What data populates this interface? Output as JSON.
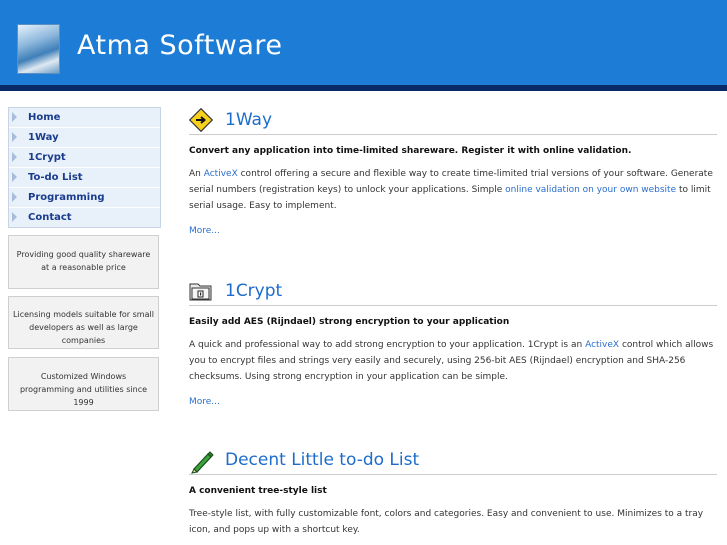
{
  "header": {
    "site_title": "Atma Software"
  },
  "nav": {
    "items": [
      {
        "label": "Home"
      },
      {
        "label": "1Way"
      },
      {
        "label": "1Crypt"
      },
      {
        "label": "To-do List"
      },
      {
        "label": "Programming"
      },
      {
        "label": "Contact"
      }
    ]
  },
  "side_boxes": [
    {
      "text": "Providing good quality shareware at a reasonable price"
    },
    {
      "text": "Licensing models suitable for small developers as well as large companies"
    },
    {
      "text": "Customized Windows programming and utilities since 1999"
    }
  ],
  "sections": [
    {
      "title": "1Way",
      "subtitle": "Convert any application into time-limited shareware. Register it with online validation.",
      "body_a": "An ",
      "link_a": "ActiveX",
      "body_b": " control offering a secure and flexible way to create time-limited trial versions of your software. Generate serial numbers (registration keys) to unlock your applications. Simple ",
      "link_b": "online validation on your own website",
      "body_c": " to limit serial usage. Easy to implement.",
      "more": "More...",
      "icon": "arrow-sign-icon"
    },
    {
      "title": "1Crypt",
      "subtitle": "Easily add AES (Rijndael) strong encryption to your application",
      "body_a": "A quick and professional way to add strong encryption to your application. 1Crypt is an ",
      "link_a": "ActiveX",
      "body_b": " control which allows you to encrypt files and strings very easily and securely, using 256-bit AES (Rijndael) encryption and SHA-256 checksums. Using strong encryption in your application can be simple.",
      "more": "More...",
      "icon": "folder-lock-icon"
    },
    {
      "title": "Decent Little to-do List",
      "subtitle": "A convenient tree-style list",
      "body_a": "Tree-style list, with fully customizable font, colors and categories. Easy and convenient to use. Minimizes to a tray icon, and pops up with a shortcut key.",
      "icon": "pencil-icon"
    }
  ],
  "colors": {
    "header": "#1d7dd6",
    "header_bar": "#0a2a66",
    "link": "#2a6fd0"
  }
}
